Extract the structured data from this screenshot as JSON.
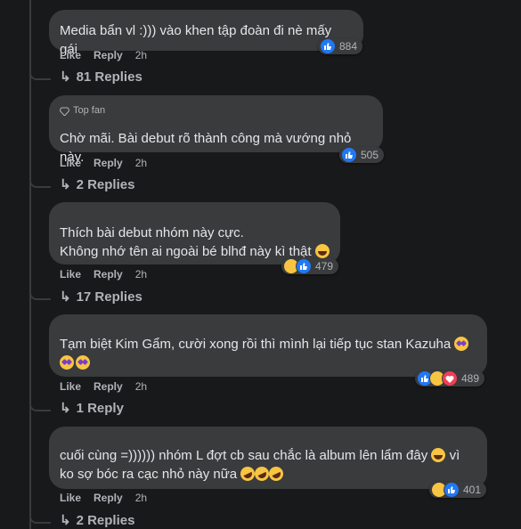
{
  "comments": [
    {
      "text": "Media bẩn vl :))) vào khen tập đoàn đi nè mấy gái",
      "count": "884",
      "like": "Like",
      "reply": "Reply",
      "time": "2h",
      "replies": "81 Replies"
    },
    {
      "badge": "Top fan",
      "text": "Chờ mãi. Bài debut rõ thành công mà vướng nhỏ này.",
      "count": "505",
      "like": "Like",
      "reply": "Reply",
      "time": "2h",
      "replies": "2 Replies"
    },
    {
      "text": "Thích bài debut nhóm này cực.\nKhông nhớ tên ai ngoài bé blhđ này kì thật",
      "count": "479",
      "like": "Like",
      "reply": "Reply",
      "time": "2h",
      "replies": "17 Replies"
    },
    {
      "text": "Tạm biệt Kim Gẩm, cười xong rồi thì mình lại tiếp tục stan Kazuha",
      "count": "489",
      "like": "Like",
      "reply": "Reply",
      "time": "2h",
      "replies": "1 Reply"
    },
    {
      "text": "cuối cùng =)))))) nhóm L đợt cb sau chắc là album lên lẩm đây",
      "text2": "vì ko sợ bóc ra cạc nhỏ này nữa",
      "count": "401",
      "like": "Like",
      "reply": "Reply",
      "time": "2h",
      "replies": "2 Replies"
    }
  ],
  "reply_arrow": "↳",
  "colors": {
    "background": "#18191a",
    "bubble": "#3a3b3c",
    "like": "#2078f4",
    "heart": "#f33e58",
    "haha": "#f7c542"
  }
}
